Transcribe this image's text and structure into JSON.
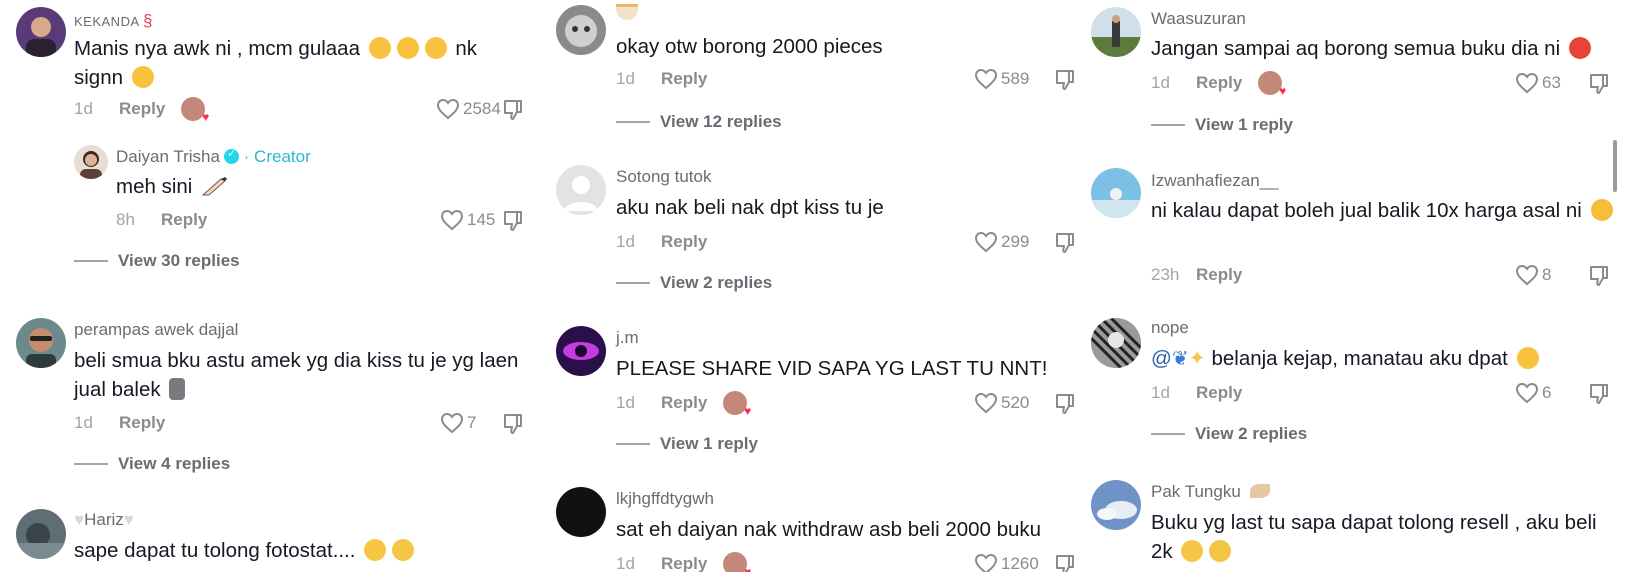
{
  "colors": {
    "heart_red": "#fe2c55",
    "creator_teal": "#2bb8d1",
    "verified": "#20d5ec",
    "meta_gray": "#8a8b91"
  },
  "icons": {
    "like": "heart-outline-icon",
    "dislike": "thumbs-down-icon",
    "verified": "verified-badge-icon",
    "creator_liked": "creator-liked-heart-icon"
  },
  "columns": [
    {
      "comments": [
        {
          "username": "KEKANDA",
          "username_suffix": "§",
          "text": "Manis nya awk ni , mcm gulaaa",
          "text_after": " nk signn",
          "time": "1d",
          "reply_label": "Reply",
          "likes": "2584",
          "creator_liked": true
        },
        {
          "username": "Daiyan Trisha",
          "creator_label": "· Creator",
          "text": "meh sini",
          "time": "8h",
          "reply_label": "Reply",
          "likes": "145",
          "view_replies": "View 30 replies"
        },
        {
          "username": "perampas awek dajjal",
          "text": "beli smua bku astu amek yg dia kiss tu je yg laen jual balek",
          "time": "1d",
          "reply_label": "Reply",
          "likes": "7",
          "view_replies": "View 4 replies"
        },
        {
          "username": "Hariz",
          "text": "sape dapat tu tolong fotostat...."
        }
      ]
    },
    {
      "comments": [
        {
          "username": "",
          "text": "okay otw borong 2000 pieces",
          "time": "1d",
          "reply_label": "Reply",
          "likes": "589",
          "view_replies": "View 12 replies"
        },
        {
          "username": "Sotong tutok",
          "text": "aku nak beli nak dpt kiss tu je",
          "time": "1d",
          "reply_label": "Reply",
          "likes": "299",
          "view_replies": "View 2 replies"
        },
        {
          "username": "j.m",
          "text": "PLEASE SHARE VID SAPA YG LAST TU NNT!",
          "time": "1d",
          "reply_label": "Reply",
          "likes": "520",
          "creator_liked": true,
          "view_replies": "View 1 reply"
        },
        {
          "username": "lkjhgffdtygwh",
          "text": "sat eh daiyan nak withdraw asb beli 2000 buku",
          "time": "1d",
          "reply_label": "Reply",
          "likes": "1260",
          "creator_liked": true
        }
      ]
    },
    {
      "comments": [
        {
          "username": "Waasuzuran",
          "text": "Jangan sampai aq borong semua buku dia ni",
          "time": "1d",
          "reply_label": "Reply",
          "likes": "63",
          "creator_liked": true,
          "view_replies": "View 1 reply"
        },
        {
          "username": "Izwanhafiezan__",
          "text": "ni kalau dapat boleh jual balik 10x harga asal ni",
          "time": "23h",
          "reply_label": "Reply",
          "likes": "8"
        },
        {
          "username": "nope",
          "text_prefix": "@",
          "text": " belanja kejap, manatau aku dpat",
          "time": "1d",
          "reply_label": "Reply",
          "likes": "6",
          "view_replies": "View 2 replies"
        },
        {
          "username": "Pak Tungku",
          "text": "Buku yg last tu sapa dapat tolong resell , aku beli 2k"
        }
      ]
    }
  ]
}
